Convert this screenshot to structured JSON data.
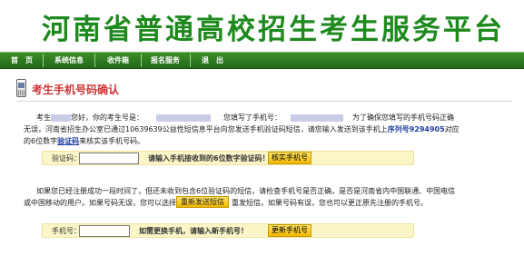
{
  "header": {
    "title": "河南省普通高校招生考生服务平台"
  },
  "nav": {
    "items": [
      "首　页",
      "系统信息",
      "收件箱",
      "报名服务",
      "退　出"
    ]
  },
  "section": {
    "title": "考生手机号码确认"
  },
  "intro": {
    "t1": "考生",
    "t2": "您好，你的考生号是：",
    "t3": "您填写了手机号：",
    "t4": "为了确保您填写的手机号码正确无误，河南省招生办公室已通过10639639公益性短信息平台向您发送手机验证码短信，请您输入发送到该手机上",
    "serial_label": "序列号9294905",
    "t5": "对应的6位数字",
    "code_link": "验证码",
    "t6": "来核实该手机号码。"
  },
  "verify": {
    "label": "验证码：",
    "value": "",
    "hint": "请输入手机接收到的6位数字验证码！",
    "button": "核实手机号"
  },
  "resend": {
    "t1": "如果您已经注册成功一段时间了，但还未收到包含6位验证码的短信，请检查手机号是否正确，是否是河南省内中国联通、中国电信或中国移动的用户。如果号码无误，您可以选择",
    "button": "重新发送短信",
    "t2": "重发短信。如果号码有误，您也可以更正原先注册的手机号。"
  },
  "phone": {
    "label": "手机号：",
    "value": "",
    "hint": "如需更换手机，请输入新手机号！",
    "button": "更新手机号"
  }
}
